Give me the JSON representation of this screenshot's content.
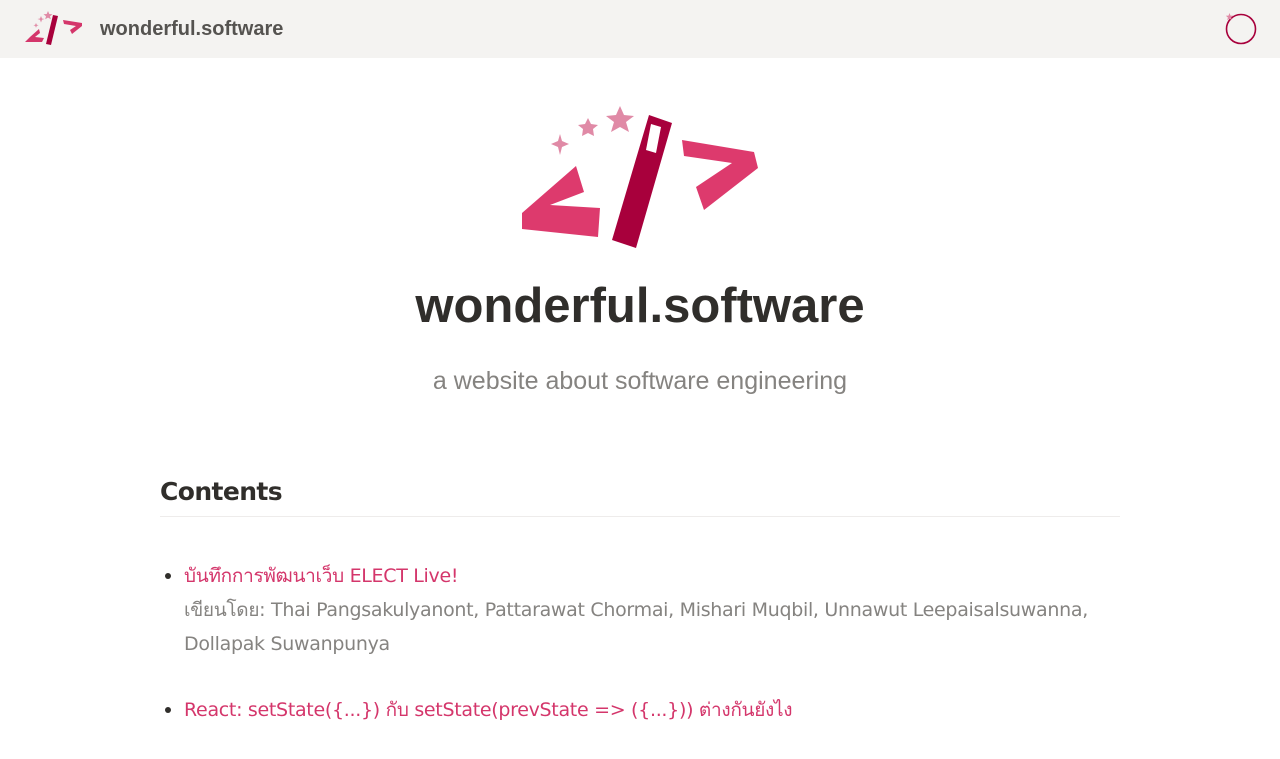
{
  "site": {
    "name": "wonderful.software",
    "tagline": "a website about software engineering"
  },
  "header": {
    "title": "wonderful.software",
    "logo_icon": "magic-wand-code-logo-icon",
    "theme_toggle_icon": "theme-toggle-circle-icon"
  },
  "contents": {
    "heading": "Contents",
    "posts": [
      {
        "title": "บันทึกการพัฒนาเว็บ ELECT Live!",
        "authors": "เขียนโดย: Thai Pangsakulyanont, Pattarawat Chormai, Mishari Muqbil, Unnawut Leepaisalsuwanna, Dollapak Suwanpunya"
      },
      {
        "title": "React: setState({...}) กับ setState(prevState => ({...})) ต่างกันยังไง",
        "authors": ""
      }
    ]
  },
  "colors": {
    "accent": "#d4366b",
    "accent_dark": "#a8003c",
    "star": "#e08aa6",
    "header_bg": "#f4f3f1",
    "title": "#302e2b",
    "muted": "#858380"
  }
}
